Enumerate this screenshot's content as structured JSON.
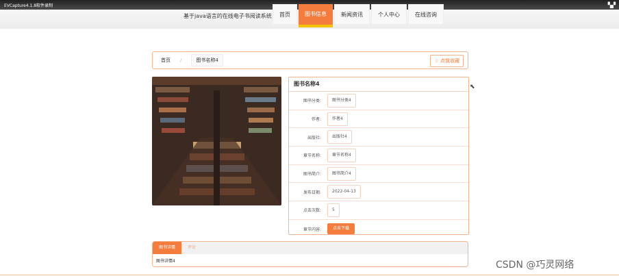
{
  "capture": {
    "title": "EVCapture4.1.8软件录制"
  },
  "header": {
    "site_title": "基于java语言的在线电子书阅读系统",
    "nav": [
      "首页",
      "图书信息",
      "新闻资讯",
      "个人中心",
      "在线咨询"
    ]
  },
  "breadcrumb": {
    "home": "首页",
    "sep": "/",
    "current": "图书名称4"
  },
  "favorite_label": "☆ 点我收藏",
  "book": {
    "title": "图书名称4",
    "fields": [
      {
        "label": "图书分类:",
        "value": "图书分类4"
      },
      {
        "label": "作者:",
        "value": "作者4"
      },
      {
        "label": "出版社:",
        "value": "出版社4"
      },
      {
        "label": "章节名称:",
        "value": "章节名称4"
      },
      {
        "label": "图书简介:",
        "value": "图书简介4"
      },
      {
        "label": "发布日期:",
        "value": "2022-04-13"
      },
      {
        "label": "点击次数:",
        "value": "5"
      }
    ],
    "chapter_label": "章节内容:",
    "download_label": "点击下载"
  },
  "detail": {
    "tabs": [
      "图书详情",
      "评论"
    ],
    "content": "图书详情4"
  },
  "watermark": "CSDN @巧灵网络",
  "colors": {
    "accent": "#f47c3c",
    "border": "#f3b48d",
    "nav_underline": "#f5c400"
  }
}
